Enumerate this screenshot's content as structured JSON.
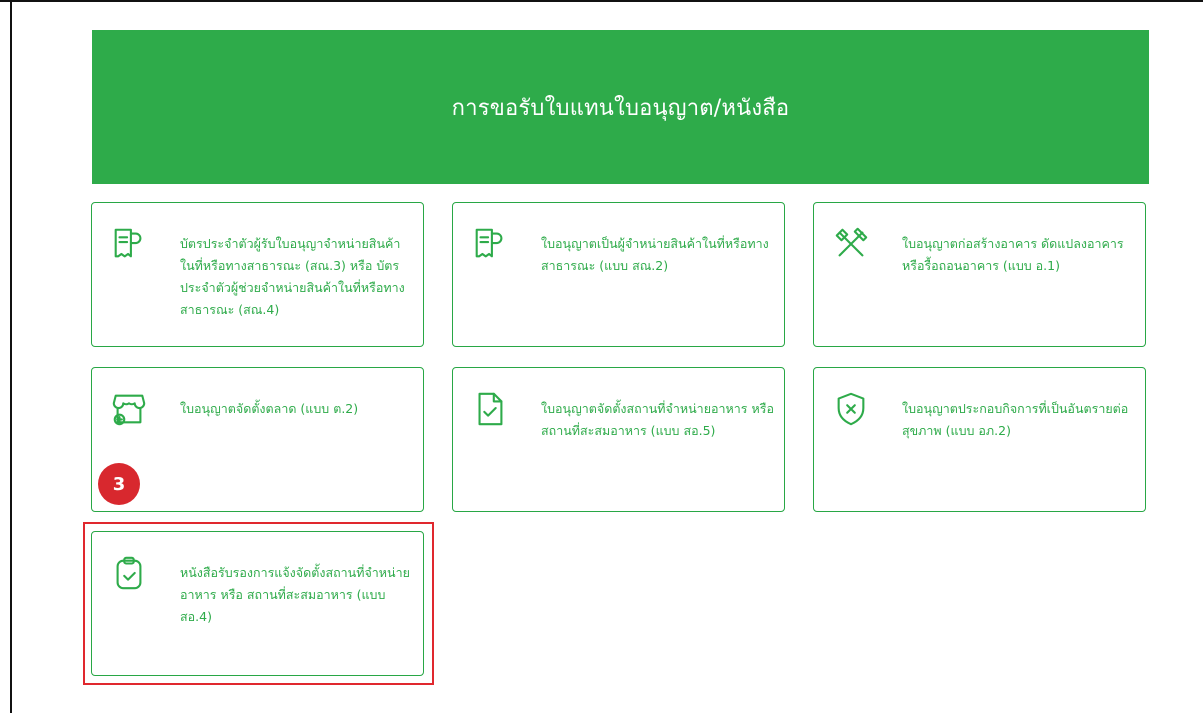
{
  "banner": {
    "title": "การขอรับใบแทนใบอนุญาต/หนังสือ"
  },
  "cards": [
    {
      "icon": "receipt-icon",
      "label": "บัตรประจำตัวผู้รับใบอนุญาจำหน่ายสินค้าในที่หรือทางสาธารณะ (สณ.3) หรือ บัตรประจำตัวผู้ช่วยจำหน่ายสินค้าในที่หรือทางสาธารณะ (สณ.4)"
    },
    {
      "icon": "receipt-icon",
      "label": "ใบอนุญาตเป็นผู้จำหน่ายสินค้าในที่หรือทางสาธารณะ (แบบ สณ.2)"
    },
    {
      "icon": "construction-tools-icon",
      "label": "ใบอนุญาตก่อสร้างอาคาร ดัดแปลงอาคาร หรือรื้อถอนอาคาร (แบบ อ.1)"
    },
    {
      "icon": "market-stall-icon",
      "label": "ใบอนุญาตจัดตั้งตลาด (แบบ ต.2)"
    },
    {
      "icon": "document-check-icon",
      "label": "ใบอนุญาตจัดตั้งสถานที่จำหน่ายอาหาร หรือสถานที่สะสมอาหาร (แบบ สอ.5)"
    },
    {
      "icon": "shield-x-icon",
      "label": "ใบอนุญาตประกอบกิจการที่เป็นอันตรายต่อสุขภาพ (แบบ อภ.2)"
    },
    {
      "icon": "clipboard-check-icon",
      "label": "หนังสือรับรองการแจ้งจัดตั้งสถานที่จำหน่ายอาหาร หรือ สถานที่สะสมอาหาร (แบบ สอ.4)"
    }
  ],
  "annotation": {
    "step": "3"
  },
  "colors": {
    "brand_green": "#2eab4a",
    "highlight_red": "#e0282e"
  }
}
